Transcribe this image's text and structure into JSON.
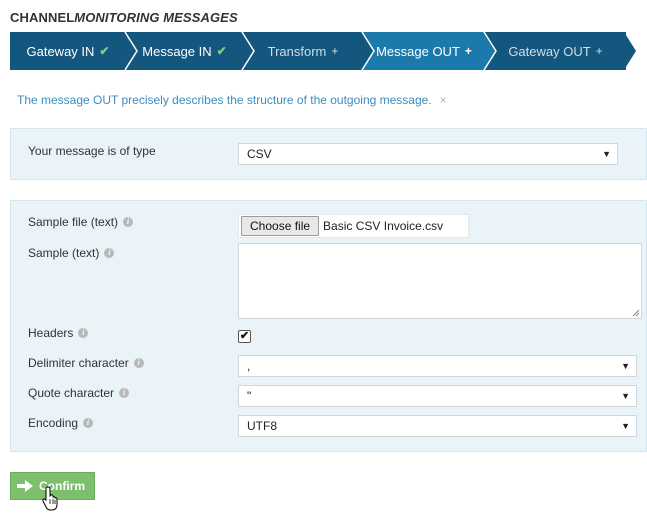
{
  "header": {
    "title_part1": "CHANNEL",
    "title_part2": "MONITORING MESSAGES"
  },
  "steps": [
    {
      "label": "Gateway IN",
      "status": "done",
      "icon": "check-icon"
    },
    {
      "label": "Message IN",
      "status": "done",
      "icon": "check-icon"
    },
    {
      "label": "Transform",
      "status": "todo",
      "icon": "plus-icon"
    },
    {
      "label": "Message OUT",
      "status": "active",
      "icon": "plus-icon"
    },
    {
      "label": "Gateway OUT",
      "status": "todo",
      "icon": "plus-icon"
    }
  ],
  "info": {
    "text": "The message OUT precisely describes the structure of the outgoing message.",
    "close": "×"
  },
  "type_panel": {
    "label": "Your message is of type",
    "value": "CSV"
  },
  "form": {
    "sample_file_label": "Sample file (text)",
    "choose_file_label": "Choose file",
    "file_name": "Basic CSV Invoice.csv",
    "sample_text_label": "Sample (text)",
    "sample_text_value": "",
    "headers_label": "Headers",
    "headers_checked": true,
    "delimiter_label": "Delimiter character",
    "delimiter_value": ",",
    "quote_label": "Quote character",
    "quote_value": "\"",
    "encoding_label": "Encoding",
    "encoding_value": "UTF8"
  },
  "confirm_label": "Confirm",
  "colors": {
    "step_dark": "#13567e",
    "step_active": "#1c79ab",
    "panel_bg": "#eaf3f8",
    "confirm_bg": "#7cbf6c",
    "info_text": "#3a8dbf"
  }
}
